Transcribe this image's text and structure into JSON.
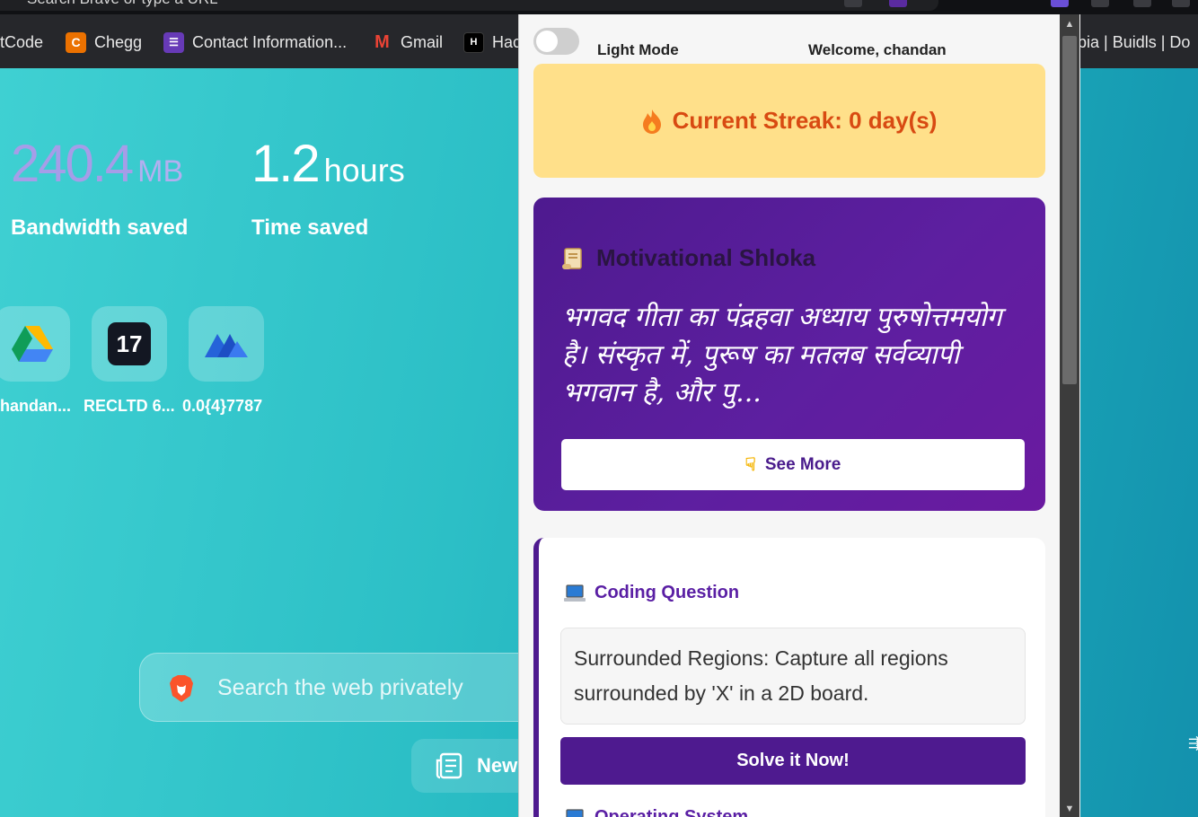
{
  "omnibox": {
    "placeholder": "Search Brave or type a URL"
  },
  "bookmarks": [
    {
      "label": "tCode",
      "icon": "none"
    },
    {
      "label": "Chegg",
      "icon": "chegg-icon",
      "letter": "C",
      "color": "#eb7100"
    },
    {
      "label": "Contact Information...",
      "icon": "forms-icon",
      "letter": "☰",
      "color": "#673ab7"
    },
    {
      "label": "Gmail",
      "icon": "gmail-icon",
      "letter": "M",
      "color": "#ea4335"
    },
    {
      "label": "Hac",
      "icon": "hackerrank-icon",
      "letter": "H",
      "color": "#000000"
    }
  ],
  "bookmarks_right": "opia | Buidls | Do",
  "ntp": {
    "bandwidth": {
      "value": "240.4",
      "unit": "MB",
      "label": "Bandwidth saved"
    },
    "time": {
      "value": "1.2",
      "unit": "hours",
      "label": "Time saved"
    },
    "tiles": [
      {
        "label": "handan...",
        "icon": "google-drive-icon"
      },
      {
        "label": "RECLTD 6...",
        "icon": "tradingview-icon"
      },
      {
        "label": "0.0{4}7787",
        "icon": "app-m-icon"
      }
    ],
    "search_placeholder": "Search the web privately",
    "news_label": "New"
  },
  "popup": {
    "mode_label": "Light Mode",
    "welcome": "Welcome, chandan",
    "streak": "Current Streak: 0 day(s)",
    "shloka_title": "Motivational Shloka",
    "shloka_text": "भगवद गीता का पंद्रहवा अध्याय पुरुषोत्तमयोग है। संस्कृत में, पुरूष का मतलब सर्वव्यापी भगवान है, और पु...",
    "see_more": "See More",
    "coding_title": "Coding Question",
    "question": "Surrounded Regions: Capture all regions surrounded by 'X' in a 2D board.",
    "solve": "Solve it Now!",
    "next_title": "Operating System"
  },
  "colors": {
    "accent": "#4e1a8f",
    "streak_bg": "#ffe08a",
    "streak_text": "#d84a12"
  }
}
